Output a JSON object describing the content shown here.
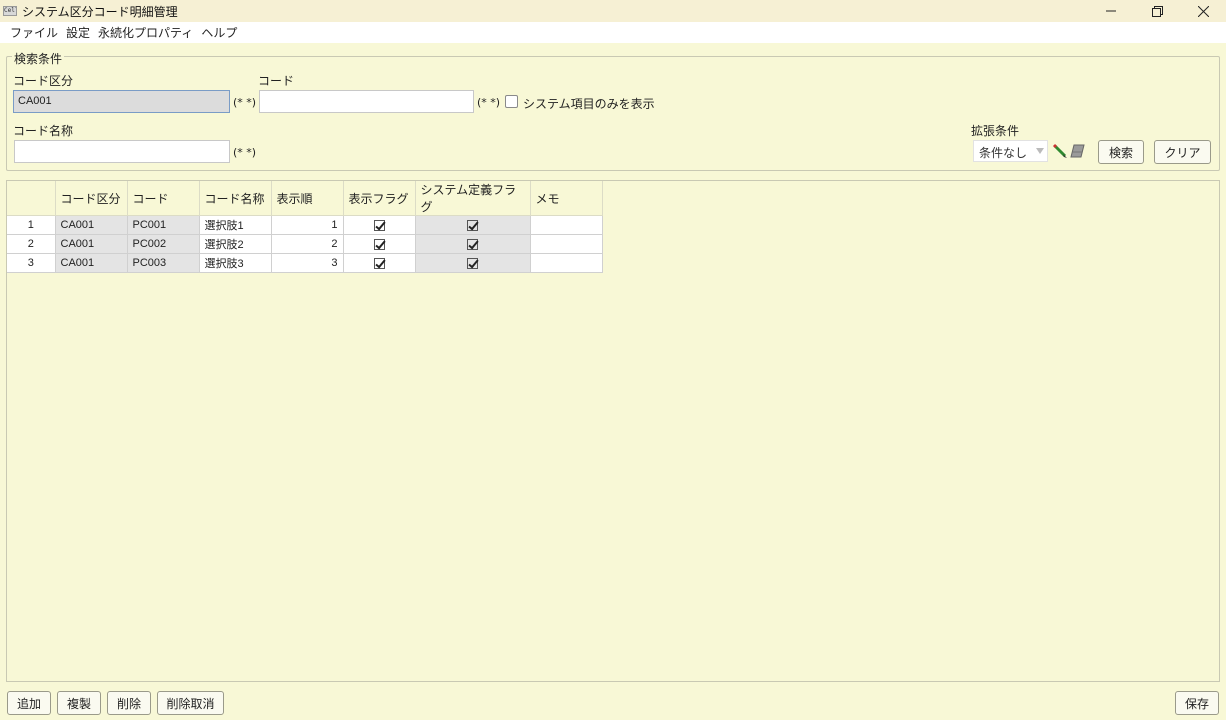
{
  "window": {
    "icon_text": "Cell",
    "title": "システム区分コード明細管理",
    "minimize_glyph": "—",
    "restore_glyph": "❐",
    "close_glyph": "✕"
  },
  "menu": [
    "ファイル",
    "設定",
    "永続化プロパティ",
    "ヘルプ"
  ],
  "search": {
    "group_title": "検索条件",
    "code_kubun_label": "コード区分",
    "code_kubun_value": "CA001",
    "code_kubun_hint": "(* *)",
    "code_label": "コード",
    "code_value": "",
    "code_hint": "(* *)",
    "system_only_label": "システム項目のみを表示",
    "code_name_label": "コード名称",
    "code_name_value": "",
    "code_name_hint": "(* *)",
    "ext_label": "拡張条件",
    "ext_selected": "条件なし",
    "search_button": "検索",
    "clear_button": "クリア"
  },
  "table": {
    "columns": [
      "コード区分",
      "コード",
      "コード名称",
      "表示順",
      "表示フラグ",
      "システム定義フラグ",
      "メモ"
    ],
    "rows": [
      {
        "no": "1",
        "code_kubun": "CA001",
        "code": "PC001",
        "name": "選択肢1",
        "order": "1",
        "display_flag": true,
        "system_flag": true,
        "memo": ""
      },
      {
        "no": "2",
        "code_kubun": "CA001",
        "code": "PC002",
        "name": "選択肢2",
        "order": "2",
        "display_flag": true,
        "system_flag": true,
        "memo": ""
      },
      {
        "no": "3",
        "code_kubun": "CA001",
        "code": "PC003",
        "name": "選択肢3",
        "order": "3",
        "display_flag": true,
        "system_flag": true,
        "memo": ""
      }
    ]
  },
  "footer": {
    "add_button": "追加",
    "copy_button": "複製",
    "delete_button": "削除",
    "undelete_button": "削除取消",
    "save_button": "保存"
  }
}
